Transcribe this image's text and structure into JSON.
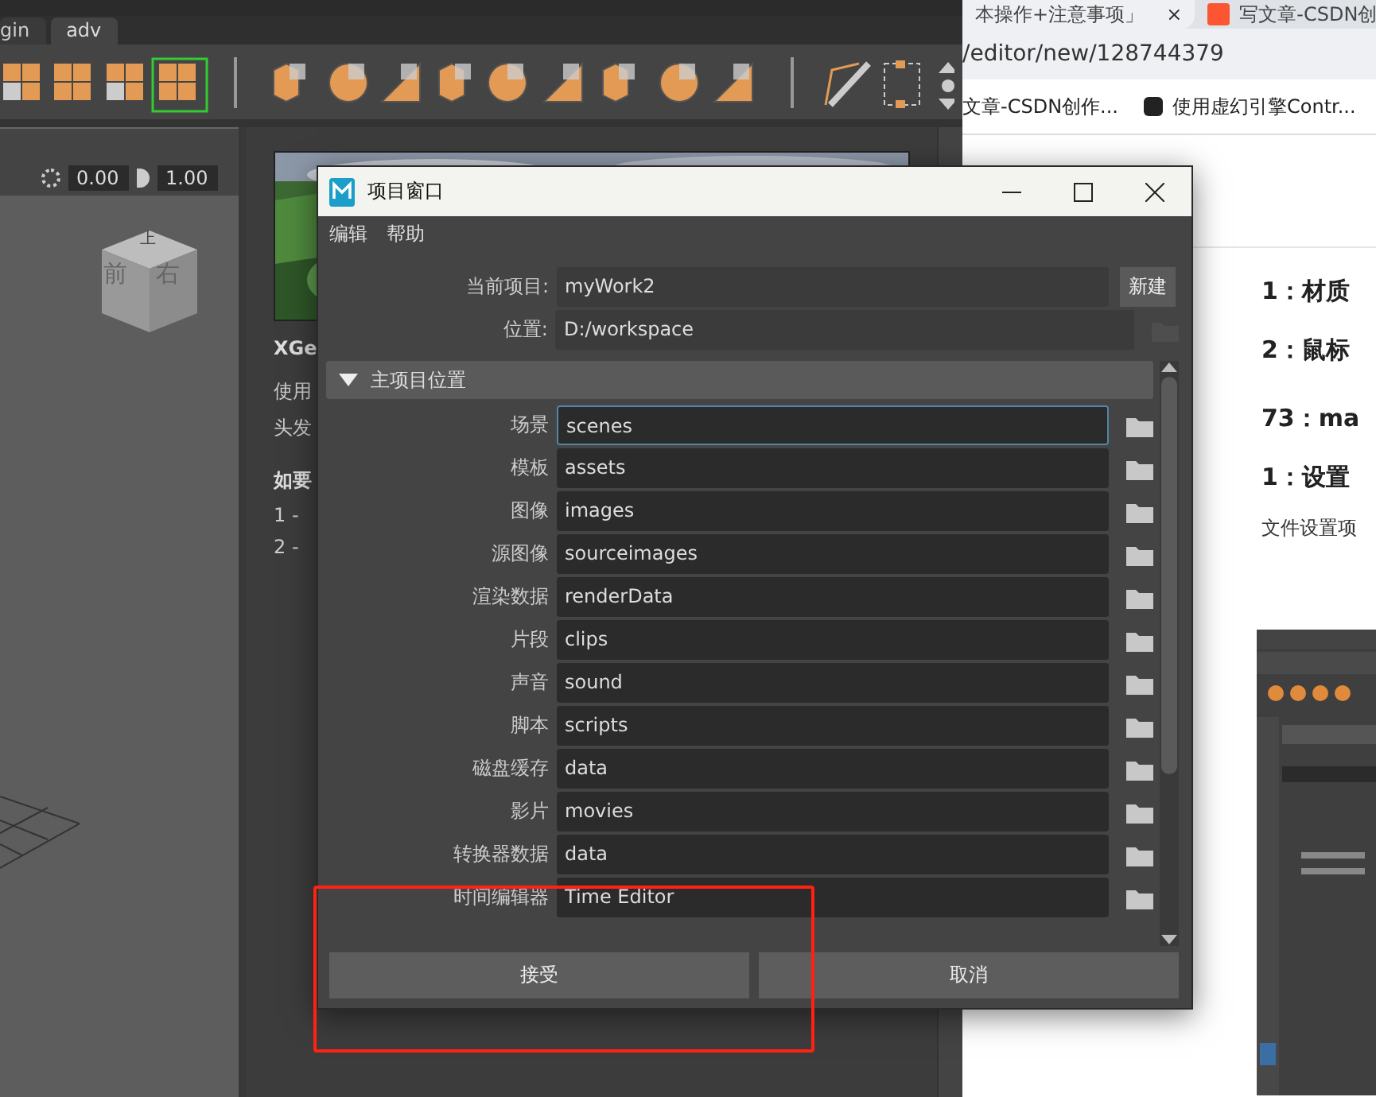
{
  "maya": {
    "shelf_tabs": [
      {
        "label": "gin",
        "selected": false
      },
      {
        "label": "adv",
        "selected": true
      }
    ],
    "viewport": {
      "field_1": "0.00",
      "field_2": "1.00",
      "view_cube": [
        "上",
        "前",
        "右"
      ]
    },
    "xgen_panel": {
      "title": "XGe",
      "lines": [
        "使用",
        "头发"
      ],
      "heading": "如要",
      "steps": [
        "1 -",
        "2 -"
      ]
    }
  },
  "browser": {
    "tabs": [
      {
        "label": "本操作+注意事项」",
        "close": "×",
        "selected": true
      },
      {
        "label": "写文章-CSDN创",
        "selected": false
      }
    ],
    "address": "/editor/new/128744379",
    "bookmarks": [
      "文章-CSDN创作...",
      "使用虚幻引擎Contr..."
    ],
    "headings": [
      "1：材质",
      "2：鼠标",
      "73：ma",
      "1：设置"
    ],
    "paragraph": "文件设置项"
  },
  "dialog": {
    "title": "项目窗口",
    "menu": [
      "编辑",
      "帮助"
    ],
    "current_project": {
      "label": "当前项目:",
      "value": "myWork2",
      "button": "新建"
    },
    "location": {
      "label": "位置:",
      "value": "D:/workspace"
    },
    "section": {
      "title": "主项目位置",
      "expanded": true
    },
    "locations": [
      {
        "label": "场景",
        "value": "scenes",
        "focused": true
      },
      {
        "label": "模板",
        "value": "assets",
        "focused": false
      },
      {
        "label": "图像",
        "value": "images",
        "focused": false
      },
      {
        "label": "源图像",
        "value": "sourceimages",
        "focused": false
      },
      {
        "label": "渲染数据",
        "value": "renderData",
        "focused": false
      },
      {
        "label": "片段",
        "value": "clips",
        "focused": false
      },
      {
        "label": "声音",
        "value": "sound",
        "focused": false
      },
      {
        "label": "脚本",
        "value": "scripts",
        "focused": false
      },
      {
        "label": "磁盘缓存",
        "value": "data",
        "focused": false
      },
      {
        "label": "影片",
        "value": "movies",
        "focused": false
      },
      {
        "label": "转换器数据",
        "value": "data",
        "focused": false
      },
      {
        "label": "时间编辑器",
        "value": "Time Editor",
        "focused": false
      }
    ],
    "buttons": [
      "接受",
      "取消"
    ]
  }
}
